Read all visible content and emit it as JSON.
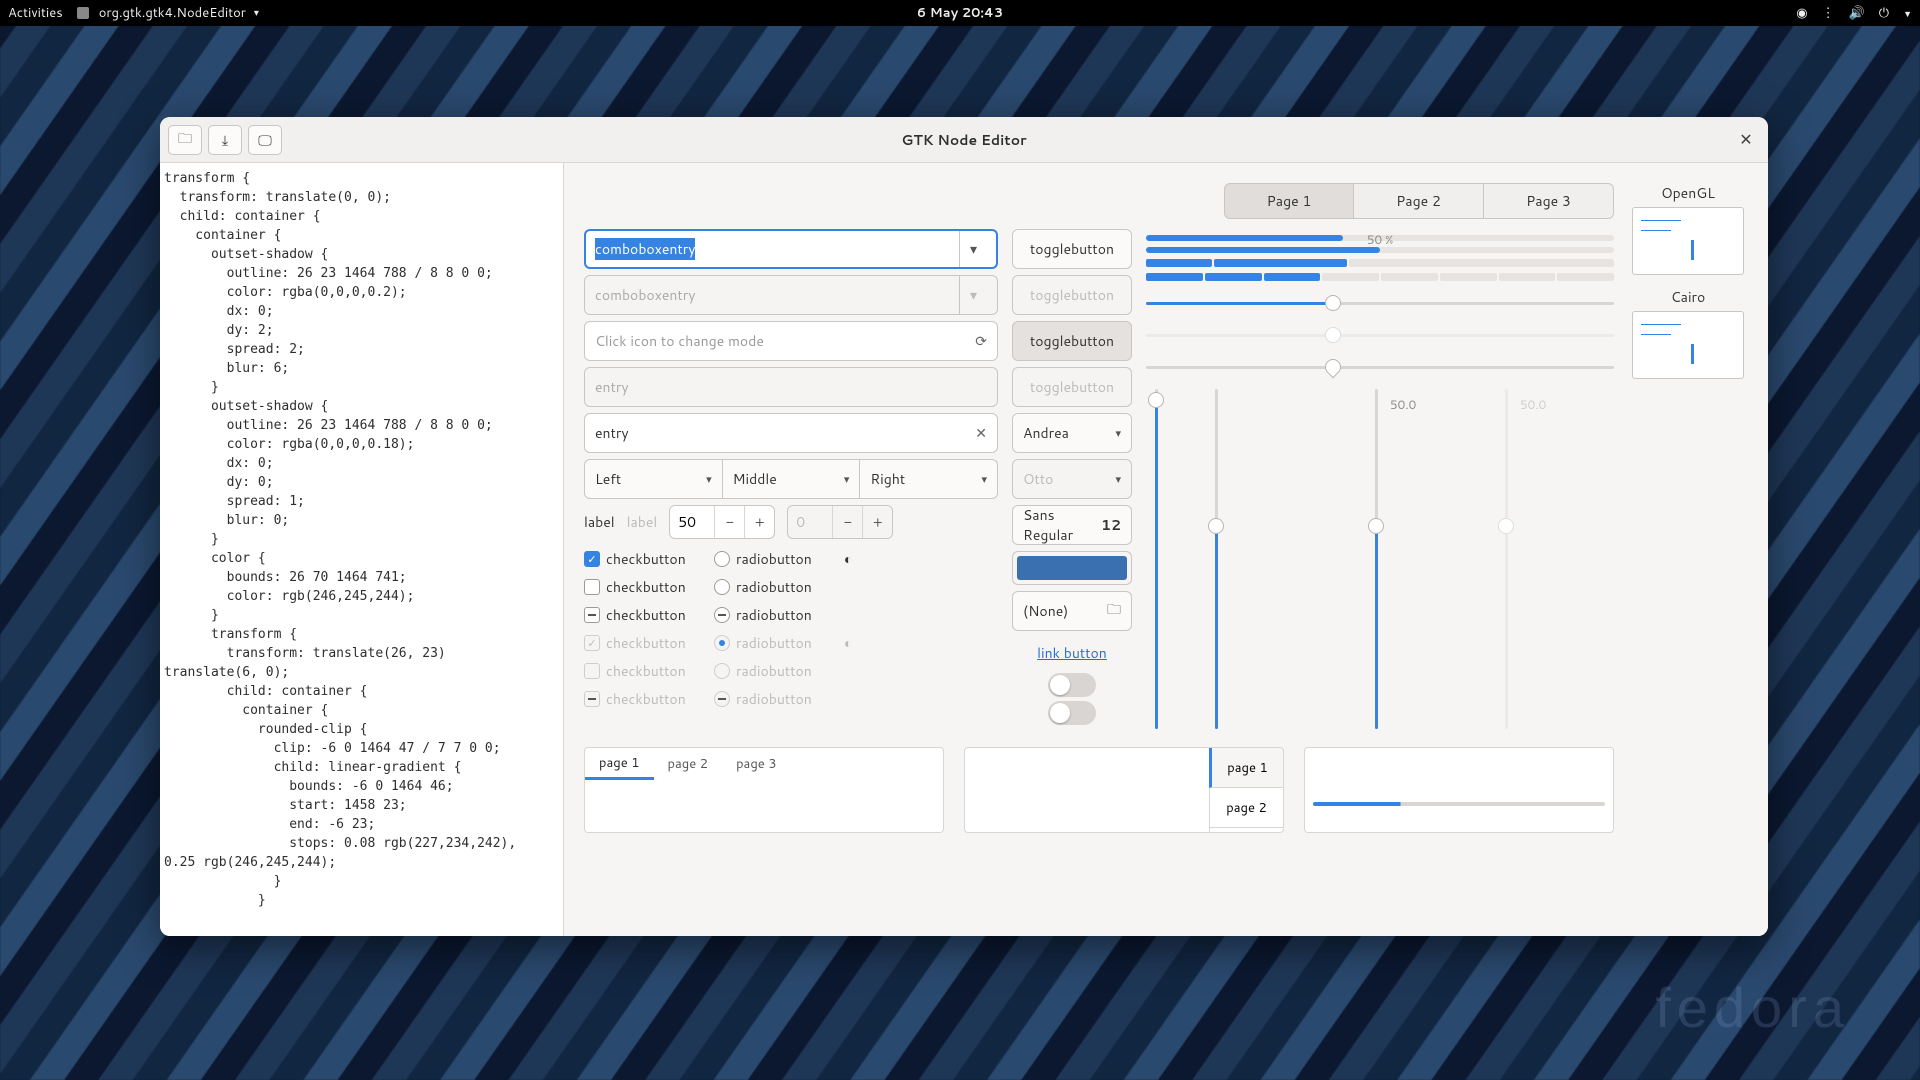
{
  "topbar": {
    "activities": "Activities",
    "app": "org.gtk.gtk4.NodeEditor",
    "clock": "6 May  20:43"
  },
  "window": {
    "title": "GTK Node Editor"
  },
  "code": "transform {\n  transform: translate(0, 0);\n  child: container {\n    container {\n      outset-shadow {\n        outline: 26 23 1464 788 / 8 8 0 0;\n        color: rgba(0,0,0,0.2);\n        dx: 0;\n        dy: 2;\n        spread: 2;\n        blur: 6;\n      }\n      outset-shadow {\n        outline: 26 23 1464 788 / 8 8 0 0;\n        color: rgba(0,0,0,0.18);\n        dx: 0;\n        dy: 0;\n        spread: 1;\n        blur: 0;\n      }\n      color {\n        bounds: 26 70 1464 741;\n        color: rgb(246,245,244);\n      }\n      transform {\n        transform: translate(26, 23)\ntranslate(6, 0);\n        child: container {\n          container {\n            rounded-clip {\n              clip: -6 0 1464 47 / 7 7 0 0;\n              child: linear-gradient {\n                bounds: -6 0 1464 46;\n                start: 1458 23;\n                end: -6 23;\n                stops: 0.08 rgb(227,234,242),\n0.25 rgb(246,245,244);\n              }\n            }",
  "notebook": {
    "tabs": [
      "Page 1",
      "Page 2",
      "Page 3"
    ],
    "active": 0
  },
  "col1": {
    "combo1": "comboboxentry",
    "combo2_ph": "comboboxentry",
    "iconentry_ph": "Click icon to change mode",
    "entry_ph": "entry",
    "entry_val": "entry",
    "seg": [
      "Left",
      "Middle",
      "Right"
    ],
    "label": "label",
    "label_dim": "label",
    "spin1": "50",
    "spin2": "0",
    "check": "checkbutton",
    "radio": "radiobutton"
  },
  "col2": {
    "toggle": "togglebutton",
    "andrea": "Andrea",
    "otto": "Otto",
    "font": "Sans Regular",
    "fontsize": "12",
    "none": "(None)",
    "link": "link button"
  },
  "col3": {
    "progress_lbl": "50 %",
    "vlabel": "50.0"
  },
  "bottom": {
    "pages": [
      "page 1",
      "page 2",
      "page 3"
    ],
    "vpages": [
      "page 1",
      "page 2"
    ]
  },
  "renderers": [
    "OpenGL",
    "Cairo"
  ]
}
